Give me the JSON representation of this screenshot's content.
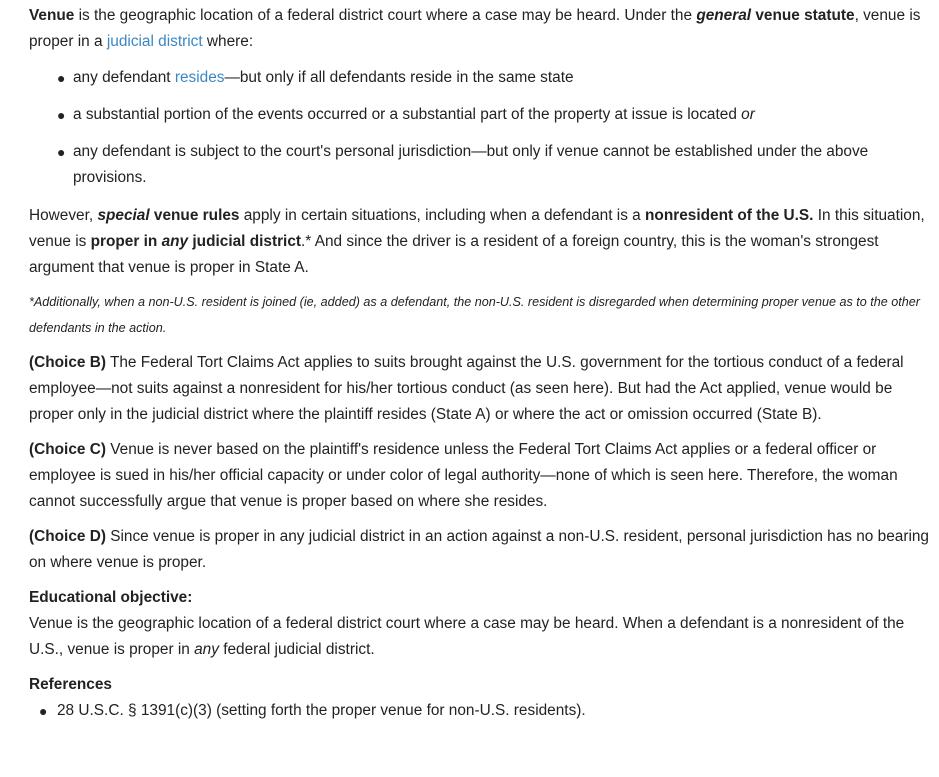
{
  "intro": {
    "term": "Venue",
    "text1": " is the geographic location of a federal district court where a case may be heard.  Under the ",
    "general": "general",
    "statute": " venue statute",
    "text2": ", venue is proper in a ",
    "link": "judicial district",
    "text3": " where:"
  },
  "bullets": {
    "b1_pre": "any defendant ",
    "b1_link": "resides",
    "b1_post": "—but only if all defendants reside in the same state",
    "b2_text": "a substantial portion of the events occurred or a substantial part of the property at issue is located ",
    "b2_or": "or",
    "b3_text": "any defendant is subject to the court's personal jurisdiction—but only if venue cannot be established under the above provisions."
  },
  "however": {
    "t1": "However, ",
    "special": "special",
    "rules": " venue rules",
    "t2": " apply in certain situations, including when a defendant is a ",
    "nonres": "nonresident of the U.S.",
    "t3": "  In this situation, venue is ",
    "proper_in": "proper in ",
    "any": "any",
    "jd": " judicial district",
    "t4": ".*  And since the driver is a resident of a foreign country, this is the woman's strongest argument that venue is proper in State A."
  },
  "footnote": "*Additionally, when a non-U.S. resident is joined (ie, added) as a defendant, the non-U.S. resident is disregarded when determining proper venue as to the other defendants in the action.",
  "choices": {
    "b_label": "(Choice B)",
    "b_text": "  The Federal Tort Claims Act applies to suits brought against the U.S. government for the tortious conduct of a federal employee—not suits against a nonresident for his/her tortious conduct (as seen here).  But had the Act applied, venue would be proper only in the judicial district where the plaintiff resides (State A) or where the act or omission occurred (State B).",
    "c_label": "(Choice C)",
    "c_text": "  Venue is never based on the plaintiff's residence unless the Federal Tort Claims Act applies or a federal officer or employee is sued in his/her official capacity or under color of legal authority—none of which is seen here.  Therefore, the woman cannot successfully argue that venue is proper based on where she resides.",
    "d_label": "(Choice D)",
    "d_text": "  Since venue is proper in any judicial district in an action against a non-U.S. resident, personal jurisdiction has no bearing on where venue is proper."
  },
  "educational": {
    "heading": "Educational objective:",
    "t1": "Venue is the geographic location of a federal district court where a case may be heard.  When a defendant is a nonresident of the U.S., venue is proper in ",
    "any": "any",
    "t2": " federal judicial district."
  },
  "references": {
    "heading": "References",
    "items": [
      "28 U.S.C. § 1391(c)(3) (setting forth the proper venue for non-U.S. residents)."
    ]
  },
  "colors": {
    "text": "#222222",
    "link": "#3b87c6",
    "background": "#ffffff"
  }
}
